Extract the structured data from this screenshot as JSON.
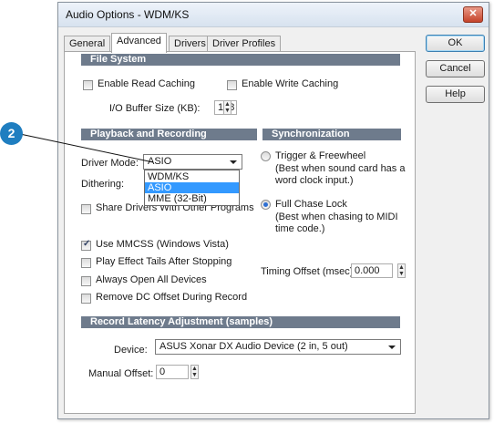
{
  "window": {
    "title": "Audio Options - WDM/KS",
    "close_symbol": "✕"
  },
  "tabs": [
    {
      "label": "General",
      "active": false
    },
    {
      "label": "Advanced",
      "active": true
    },
    {
      "label": "Drivers",
      "active": false
    },
    {
      "label": "Driver Profiles",
      "active": false
    }
  ],
  "buttons": {
    "ok": "OK",
    "cancel": "Cancel",
    "help": "Help"
  },
  "file_system": {
    "header": "File System",
    "read_caching": {
      "label": "Enable Read Caching",
      "checked": false
    },
    "write_caching": {
      "label": "Enable Write Caching",
      "checked": false
    },
    "io_buffer_label": "I/O Buffer Size (KB):",
    "io_buffer_value": "128"
  },
  "playback": {
    "header": "Playback and Recording",
    "driver_mode_label": "Driver Mode:",
    "driver_mode_value": "ASIO",
    "driver_mode_options": [
      "WDM/KS",
      "ASIO",
      "MME (32-Bit)"
    ],
    "dithering_label": "Dithering:",
    "share_drivers": {
      "label": "Share Drivers With Other Programs",
      "checked": false
    },
    "use_mmcss": {
      "label": "Use MMCSS (Windows Vista)",
      "checked": true
    },
    "play_effect_tails": {
      "label": "Play Effect Tails After Stopping",
      "checked": false
    },
    "always_open": {
      "label": "Always Open All Devices",
      "checked": false
    },
    "remove_dc": {
      "label": "Remove DC Offset During Record",
      "checked": false
    }
  },
  "sync": {
    "header": "Synchronization",
    "trigger": {
      "label": "Trigger & Freewheel",
      "desc1": "(Best when sound card has a",
      "desc2": "word clock input.)",
      "checked": false
    },
    "chase": {
      "label": "Full Chase Lock",
      "desc1": "(Best when chasing to MIDI",
      "desc2": "time code.)",
      "checked": true
    },
    "timing_offset_label": "Timing Offset (msec):",
    "timing_offset_value": "0.000"
  },
  "latency": {
    "header": "Record Latency Adjustment (samples)",
    "device_label": "Device:",
    "device_value": "ASUS Xonar DX Audio Device (2 in, 5 out)",
    "manual_offset_label": "Manual Offset:",
    "manual_offset_value": "0"
  },
  "callout": {
    "number": "2",
    "color": "#1f7ec0"
  }
}
